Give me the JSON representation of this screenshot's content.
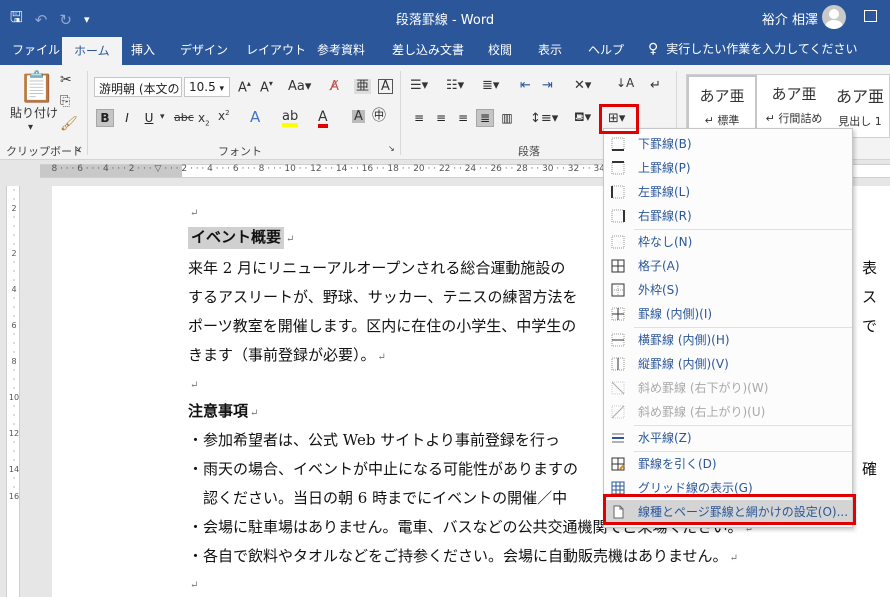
{
  "titlebar": {
    "doc_title": "段落罫線 - Word",
    "user_name": "裕介 相澤"
  },
  "tabs": [
    {
      "label": "ファイル"
    },
    {
      "label": "ホーム"
    },
    {
      "label": "挿入"
    },
    {
      "label": "デザイン"
    },
    {
      "label": "レイアウト"
    },
    {
      "label": "参考資料"
    },
    {
      "label": "差し込み文書"
    },
    {
      "label": "校閲"
    },
    {
      "label": "表示"
    },
    {
      "label": "ヘルプ"
    }
  ],
  "tell_me": "実行したい作業を入力してください",
  "ribbon": {
    "paste_label": "貼り付け",
    "group_clipboard": "クリップボード",
    "group_font": "フォント",
    "group_paragraph": "段落",
    "font_name": "游明朝 (本文のフ",
    "font_size": "10.5",
    "styles": [
      {
        "sample": "あア亜",
        "name": "↵ 標準"
      },
      {
        "sample": "あア亜",
        "name": "↵ 行間詰め"
      },
      {
        "sample": "あア亜",
        "name": "見出し 1"
      }
    ]
  },
  "document": {
    "lines": [
      "",
      "イベント概要",
      "来年 2 月にリニューアルオープンされる総合運動施設の",
      "するアスリートが、野球、サッカー、テニスの練習方法を",
      "ポーツ教室を開催します。区内に在住の小学生、中学生の",
      "きます（事前登録が必要）。",
      "",
      "注意事項",
      "・参加希望者は、公式 Web サイトより事前登録を行っ",
      "・雨天の場合、イベントが中止になる可能性がありますの",
      "　認ください。当日の朝 6 時までにイベントの開催／中",
      "・会場に駐車場はありません。電車、バスなどの公共交通機関でご来場ください。",
      "・各自で飲料やタオルなどをご持参ください。会場に自動販売機はありません。",
      ""
    ],
    "right_fragments": [
      "表",
      "ス",
      "で",
      "確"
    ]
  },
  "border_menu": {
    "items": [
      {
        "label": "下罫線(B)",
        "disabled": false
      },
      {
        "label": "上罫線(P)",
        "disabled": false
      },
      {
        "label": "左罫線(L)",
        "disabled": false
      },
      {
        "label": "右罫線(R)",
        "disabled": false
      },
      {
        "label": "枠なし(N)",
        "disabled": false
      },
      {
        "label": "格子(A)",
        "disabled": false
      },
      {
        "label": "外枠(S)",
        "disabled": false
      },
      {
        "label": "罫線 (内側)(I)",
        "disabled": false
      },
      {
        "label": "横罫線 (内側)(H)",
        "disabled": false
      },
      {
        "label": "縦罫線 (内側)(V)",
        "disabled": false
      },
      {
        "label": "斜め罫線 (右下がり)(W)",
        "disabled": true
      },
      {
        "label": "斜め罫線 (右上がり)(U)",
        "disabled": true
      },
      {
        "label": "水平線(Z)",
        "disabled": false
      },
      {
        "label": "罫線を引く(D)",
        "disabled": false
      },
      {
        "label": "グリッド線の表示(G)",
        "disabled": false
      },
      {
        "label": "線種とページ罫線と網かけの設定(O)...",
        "disabled": false
      }
    ]
  },
  "colors": {
    "title_blue": "#2b579a",
    "highlight_red": "#e00000"
  }
}
